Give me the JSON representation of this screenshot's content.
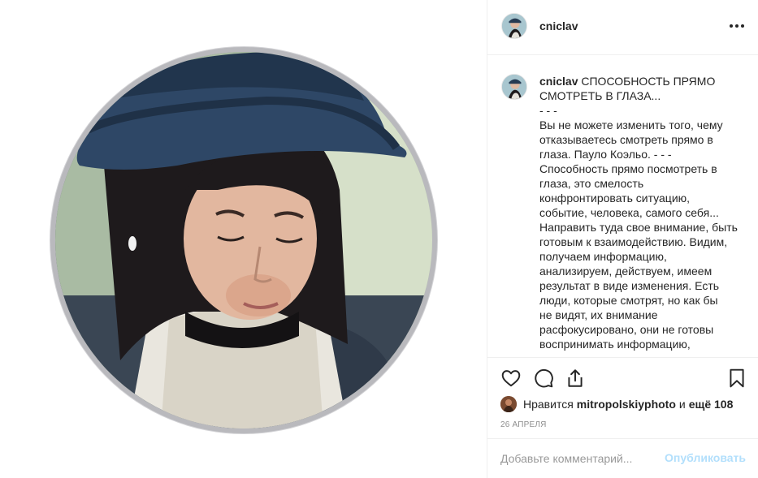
{
  "post": {
    "username": "cniclav",
    "photo_alt": "portrait-photo",
    "more_icon": "more-horizontal-icon"
  },
  "caption": {
    "username": "cniclav",
    "lines": [
      "СПОСОБНОСТЬ ПРЯМО",
      "СМОТРЕТЬ В ГЛАЗА...",
      "- - -",
      "Вы не можете изменить того, чему",
      "отказываетесь смотреть прямо в",
      "глаза. Пауло Коэльо. - - -",
      "Способность прямо посмотреть в",
      "глаза, это смелость",
      "конфронтировать ситуацию,",
      "событие, человека, самого себя...",
      "Направить туда свое внимание, быть",
      "готовым к взаимодействию. Видим,",
      "получаем информацию,",
      "анализируем, действуем, имеем",
      "результат в виде изменения. Есть",
      "люди, которые смотрят, но как бы",
      "не видят, их внимание",
      "расфокусировано, они не готовы",
      "воспринимать информацию,"
    ]
  },
  "actions": {
    "like_icon": "heart-icon",
    "comment_icon": "comment-icon",
    "share_icon": "share-icon",
    "save_icon": "bookmark-icon"
  },
  "likes": {
    "prefix": "Нравится",
    "liker": "mitropolskiyphoto",
    "connector": "и",
    "more": "ещё 108"
  },
  "date": "26 АПРЕЛЯ",
  "comment": {
    "placeholder": "Добавьте комментарий...",
    "publish_label": "Опубликовать"
  },
  "colors": {
    "text": "#262626",
    "muted": "#8e8e8e",
    "border": "#efefef",
    "publish_disabled": "#b2dffc"
  }
}
